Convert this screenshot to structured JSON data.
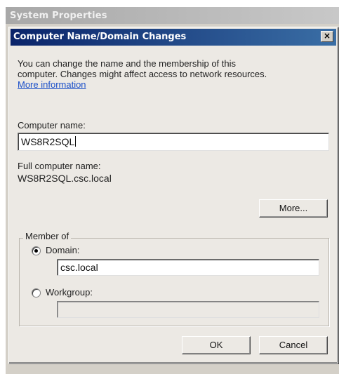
{
  "outer_window": {
    "title": "System Properties"
  },
  "dialog": {
    "title": "Computer Name/Domain Changes",
    "close_label": "×",
    "description_line1": "You can change the name and the membership of this",
    "description_line2": "computer. Changes might affect access to network resources.",
    "more_info_link": "More information",
    "computer_name_label": "Computer name:",
    "computer_name_value": "WS8R2SQL",
    "full_name_label": "Full computer name:",
    "full_name_value": "WS8R2SQL.csc.local",
    "more_button": "More...",
    "member_of_legend": "Member of",
    "domain_label": "Domain:",
    "domain_value": "csc.local",
    "domain_selected": true,
    "workgroup_label": "Workgroup:",
    "workgroup_value": "",
    "workgroup_selected": false,
    "ok_button": "OK",
    "cancel_button": "Cancel"
  }
}
